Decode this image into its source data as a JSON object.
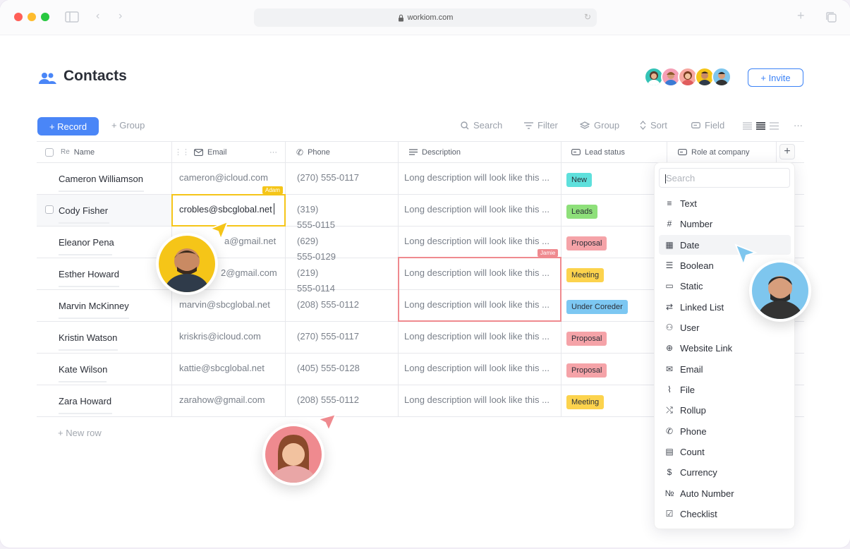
{
  "browser": {
    "url": "workiom.com"
  },
  "page": {
    "title": "Contacts"
  },
  "header": {
    "invite_label": "+ Invite"
  },
  "toolbar": {
    "record_label": "+ Record",
    "group_label": "+ Group",
    "search_label": "Search",
    "filter_label": "Filter",
    "group_tool_label": "Group",
    "sort_label": "Sort",
    "field_label": "Field",
    "more_label": "···"
  },
  "columns": {
    "name": "Name",
    "email": "Email",
    "phone": "Phone",
    "description": "Description",
    "lead_status": "Lead status",
    "role": "Role at company"
  },
  "rows": [
    {
      "name": "Cameron Williamson",
      "email": "cameron@icloud.com",
      "phone": "(270) 555-0117",
      "description": "Long description will look like this ...",
      "status": "New"
    },
    {
      "name": "Cody Fisher",
      "email": "crobles@sbcglobal.net",
      "phone": "(319)",
      "phone2": "555-0115",
      "description": "Long description will look like this ...",
      "status": "Leads"
    },
    {
      "name": "Eleanor Pena",
      "email": "a@gmail.net",
      "phone": "(629)",
      "phone2": "555-0129",
      "description": "Long description will look like this ...",
      "status": "Proposal"
    },
    {
      "name": "Esther Howard",
      "email": "2@gmail.com",
      "phone": "(219)",
      "phone2": "555-0114",
      "description": "Long description will look like this ...",
      "status": "Meeting"
    },
    {
      "name": "Marvin McKinney",
      "email": "marvin@sbcglobal.net",
      "phone": "(208) 555-0112",
      "description": "Long description will look like this ...",
      "status": "Under Coreder"
    },
    {
      "name": "Kristin Watson",
      "email": "kriskris@icloud.com",
      "phone": "(270) 555-0117",
      "description": "Long description will look like this ...",
      "status": "Proposal"
    },
    {
      "name": "Kate Wilson",
      "email": "kattie@sbcglobal.net",
      "phone": "(405) 555-0128",
      "description": "Long description will look like this ...",
      "status": "Proposal"
    },
    {
      "name": "Zara Howard",
      "email": "zarahow@gmail.com",
      "phone": "(208) 555-0112",
      "description": "Long description will look like this ...",
      "status": "Meeting"
    }
  ],
  "new_row_label": "+ New row",
  "collaborators": {
    "adam": "Adam",
    "jamie": "Jamie"
  },
  "field_menu": {
    "search_placeholder": "Search",
    "items": [
      "Text",
      "Number",
      "Date",
      "Boolean",
      "Static",
      "Linked List",
      "User",
      "Website Link",
      "Email",
      "File",
      "Rollup",
      "Phone",
      "Count",
      "Currency",
      "Auto Number",
      "Checklist"
    ],
    "active": "Date"
  },
  "colors": {
    "accent": "#4a86f7",
    "new": "#5ee0dc",
    "leads": "#8ee07a",
    "proposal": "#f5a3a8",
    "meeting": "#fcd34d",
    "under": "#7cc7f2",
    "adam": "#f5c518",
    "jamie": "#ef8a8f"
  }
}
